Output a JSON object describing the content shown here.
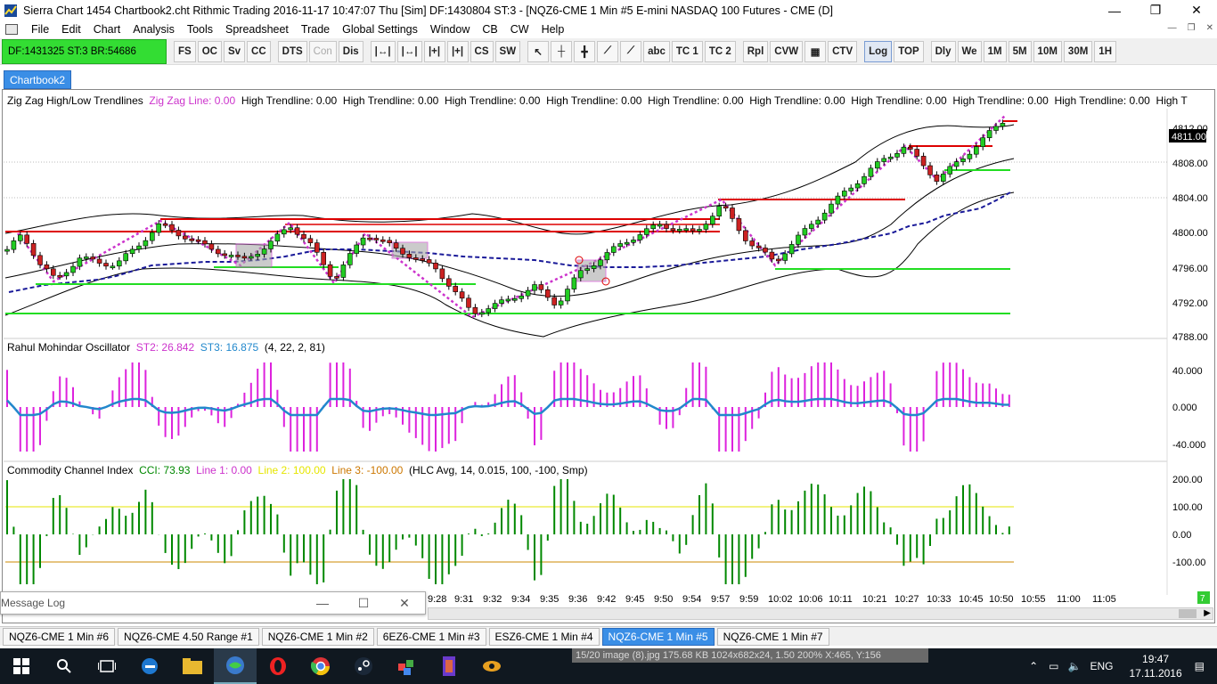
{
  "window": {
    "title": "Sierra Chart 1454 Chartbook2.cht  Rithmic Trading 2016-11-17  10:47:07 Thu [Sim]  DF:1430804  ST:3 - [NQZ6-CME  1 Min  #5  E-mini NASDAQ 100 Futures - CME (D]",
    "minimize": "—",
    "maximize": "❐",
    "close": "✕"
  },
  "menu": [
    "File",
    "Edit",
    "Chart",
    "Analysis",
    "Tools",
    "Spreadsheet",
    "Trade",
    "Global Settings",
    "Window",
    "CB",
    "CW",
    "Help"
  ],
  "toolbar": {
    "status": "DF:1431325  ST:3  BR:54686",
    "buttons_a": [
      "FS",
      "OC",
      "Sv",
      "CC"
    ],
    "buttons_b": [
      "DTS",
      "Con",
      "Dis"
    ],
    "buttons_c": [
      "CS",
      "SW"
    ],
    "buttons_d": [
      "abc",
      "TC 1",
      "TC 2"
    ],
    "buttons_e": [
      "Rpl",
      "CVW"
    ],
    "buttons_f": [
      "CTV"
    ],
    "buttons_g": [
      "Log",
      "TOP"
    ],
    "buttons_h": [
      "Dly",
      "We",
      "1M",
      "5M",
      "10M",
      "30M",
      "1H"
    ]
  },
  "chartbook_tab": "Chartbook2",
  "studies": {
    "zigzag": {
      "name": "Zig Zag High/Low Trendlines",
      "line": "Zig Zag Line: 0.00",
      "high": "High Trendline: 0.00",
      "tail": "High T"
    },
    "rmo": {
      "name": "Rahul Mohindar Oscillator",
      "st2": "ST2: 26.842",
      "st3": "ST3: 16.875",
      "params": "(4, 22, 2, 81)"
    },
    "cci": {
      "name": "Commodity Channel Index",
      "cci": "CCI: 73.93",
      "l1": "Line 1: 0.00",
      "l2": "Line 2: 100.00",
      "l3": "Line 3: -100.00",
      "params": "(HLC Avg, 14, 0.015, 100, -100, Smp)"
    }
  },
  "price_axis": [
    "4812.00",
    "4808.00",
    "4804.00",
    "4800.00",
    "4796.00",
    "4792.00",
    "4788.00"
  ],
  "current_price": "4811.00",
  "rmo_axis": [
    "40.000",
    "0.000",
    "-40.000"
  ],
  "cci_axis": [
    "200.00",
    "100.00",
    "0.00",
    "-100.00"
  ],
  "time_axis": [
    "9:28",
    "9:31",
    "9:32",
    "9:34",
    "9:35",
    "9:36",
    "9:42",
    "9:45",
    "9:50",
    "9:54",
    "9:57",
    "9:59",
    "10:02",
    "10:06",
    "10:11",
    "10:21",
    "10:27",
    "10:33",
    "10:45",
    "10:50",
    "10:55",
    "11:00",
    "11:05"
  ],
  "message_log": "Message Log",
  "bottom_tabs": [
    "NQZ6-CME  1 Min  #6",
    "NQZ6-CME  4.50 Range  #1",
    "NQZ6-CME  1 Min  #2",
    "6EZ6-CME  1 Min  #3",
    "ESZ6-CME  1 Min  #4",
    "NQZ6-CME  1 Min  #5",
    "NQZ6-CME  1 Min  #7"
  ],
  "active_tab_index": 5,
  "image_status": "15/20    image (8).jpg    175.68 KB    1024x682x24, 1.50    200%    X:465, Y:156",
  "tray": {
    "lang": "ENG",
    "time": "19:47",
    "date": "17.11.2016"
  },
  "colors": {
    "status_green": "#33dd33",
    "accent_blue": "#3a8ee6",
    "zigzag_magenta": "#cc33cc",
    "cci_green": "#008800",
    "trend_red": "#dd0000",
    "trend_green": "#22dd22"
  }
}
